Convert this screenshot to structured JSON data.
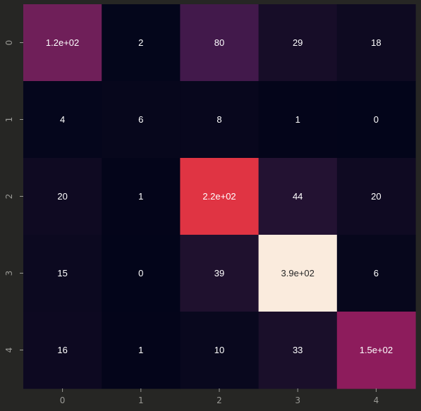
{
  "background_color": "#262624",
  "tick_color": "#9a9a96",
  "chart_data": {
    "type": "heatmap",
    "x_labels": [
      "0",
      "1",
      "2",
      "3",
      "4"
    ],
    "y_labels": [
      "0",
      "1",
      "2",
      "3",
      "4"
    ],
    "values": [
      [
        120,
        2,
        80,
        29,
        18
      ],
      [
        4,
        6,
        8,
        1,
        0
      ],
      [
        20,
        1,
        220,
        44,
        20
      ],
      [
        15,
        0,
        39,
        390,
        6
      ],
      [
        16,
        1,
        10,
        33,
        150
      ]
    ],
    "annotations": [
      [
        "1.2e+02",
        "2",
        "80",
        "29",
        "18"
      ],
      [
        "4",
        "6",
        "8",
        "1",
        "0"
      ],
      [
        "20",
        "1",
        "2.2e+02",
        "44",
        "20"
      ],
      [
        "15",
        "0",
        "39",
        "3.9e+02",
        "6"
      ],
      [
        "16",
        "1",
        "10",
        "33",
        "1.5e+02"
      ]
    ],
    "colormap": "rocket",
    "colorbar": false,
    "grid": false
  }
}
